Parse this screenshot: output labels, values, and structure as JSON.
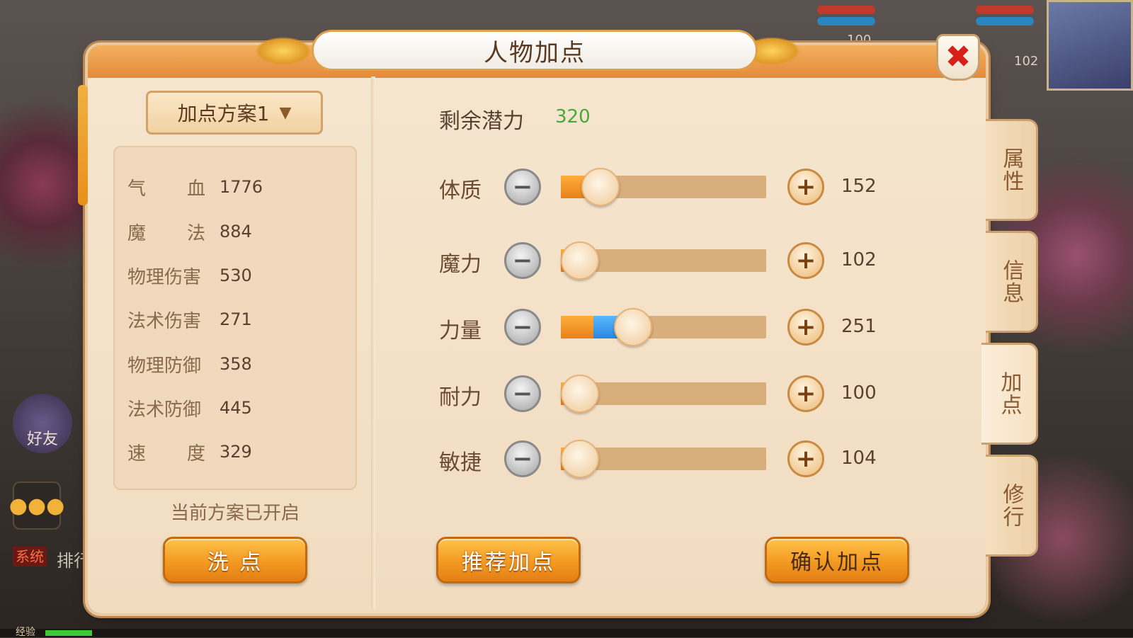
{
  "window": {
    "title": "人物加点",
    "close_icon": "close-icon"
  },
  "hud": {
    "top_value_left": "100",
    "top_value_right": "102"
  },
  "plan": {
    "selected": "加点方案1",
    "status": "当前方案已开启",
    "reset_button": "洗 点"
  },
  "stats": [
    {
      "label_a": "气",
      "label_b": "血",
      "value": "1776"
    },
    {
      "label_a": "魔",
      "label_b": "法",
      "value": "884"
    },
    {
      "label": "物理伤害",
      "value": "530"
    },
    {
      "label": "法术伤害",
      "value": "271"
    },
    {
      "label": "物理防御",
      "value": "358"
    },
    {
      "label": "法术防御",
      "value": "445"
    },
    {
      "label_a": "速",
      "label_b": "度",
      "value": "329"
    }
  ],
  "potential": {
    "label": "剩余潜力",
    "value": "320"
  },
  "attributes": [
    {
      "label": "体质",
      "value": "152",
      "fill_orange": 0.18,
      "fill_blue": 0.0
    },
    {
      "label": "魔力",
      "value": "102",
      "fill_orange": 0.02,
      "fill_blue": 0.0
    },
    {
      "label": "力量",
      "value": "251",
      "fill_orange": 0.16,
      "fill_blue": 0.18
    },
    {
      "label": "耐力",
      "value": "100",
      "fill_orange": 0.02,
      "fill_blue": 0.0
    },
    {
      "label": "敏捷",
      "value": "104",
      "fill_orange": 0.02,
      "fill_blue": 0.0
    }
  ],
  "buttons": {
    "recommend": "推荐加点",
    "confirm": "确认加点"
  },
  "side_tabs": [
    {
      "label": "属性",
      "active": false
    },
    {
      "label": "信息",
      "active": false
    },
    {
      "label": "加点",
      "active": true
    },
    {
      "label": "修行",
      "active": false
    }
  ],
  "bottom_hud": {
    "friend_label": "好友",
    "chat_icon": "chat-bubble-icon",
    "system_tag": "系统",
    "system_text": "排行",
    "exp_label": "经验"
  },
  "colors": {
    "accent_orange": "#f39a22",
    "potential_green": "#4aa83a",
    "close_red": "#d8201a",
    "fill_blue": "#2a86e0"
  }
}
